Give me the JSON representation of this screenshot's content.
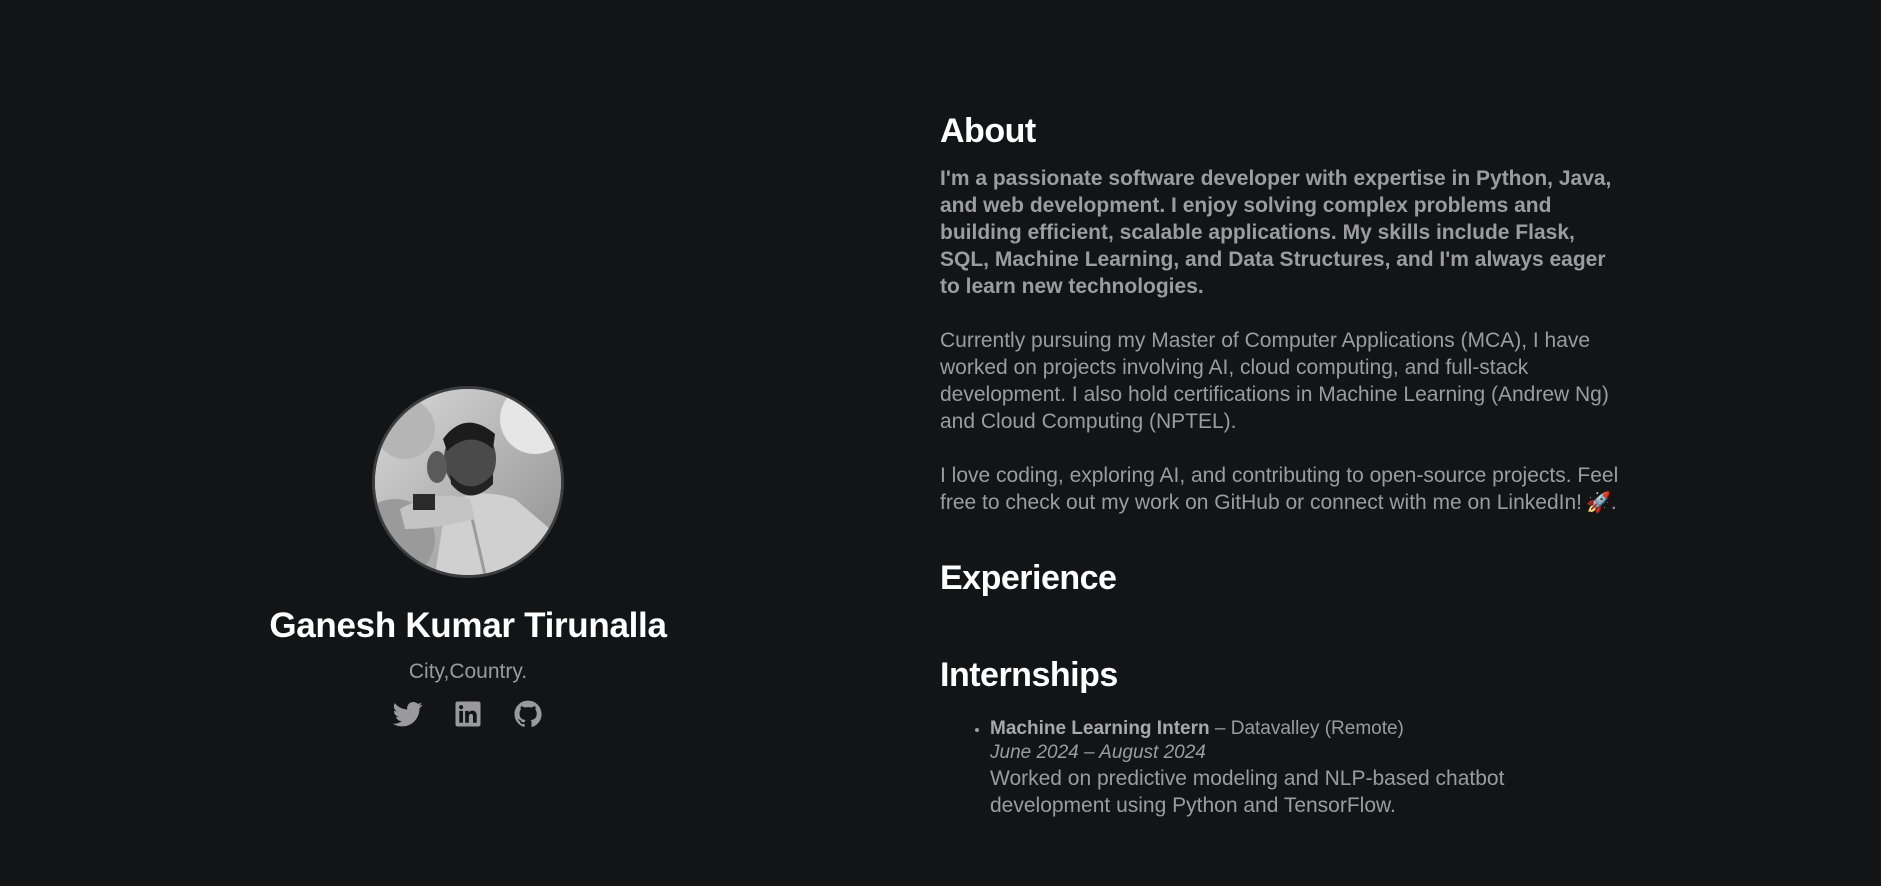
{
  "profile": {
    "name": "Ganesh Kumar Tirunalla",
    "location": "City,Country.",
    "socials": [
      {
        "icon": "twitter-icon"
      },
      {
        "icon": "linkedin-icon"
      },
      {
        "icon": "github-icon"
      }
    ]
  },
  "about": {
    "heading": "About",
    "p1": "I'm a passionate software developer with expertise in Python, Java, and web development. I enjoy solving complex problems and building efficient, scalable applications. My skills include Flask, SQL, Machine Learning, and Data Structures, and I'm always eager to learn new technologies.",
    "p2": "Currently pursuing my Master of Computer Applications (MCA), I have worked on projects involving AI, cloud computing, and full-stack development. I also hold certifications in Machine Learning (Andrew Ng) and Cloud Computing (NPTEL).",
    "p3": "I love coding, exploring AI, and contributing to open-source projects. Feel free to check out my work on GitHub or connect with me on LinkedIn!",
    "p3_end": ".",
    "rocket_icon": "rocket-icon"
  },
  "experience": {
    "heading": "Experience"
  },
  "internships": {
    "heading": "Internships",
    "items": [
      {
        "role": "Machine Learning Intern",
        "company": " – Datavalley (Remote)",
        "dates": "June 2024 – August 2024",
        "description": "Worked on predictive modeling and NLP-based chatbot development using Python and TensorFlow."
      }
    ]
  },
  "colors": {
    "background": "#131416",
    "heading": "#ffffff",
    "text": "#9c9ca0"
  }
}
